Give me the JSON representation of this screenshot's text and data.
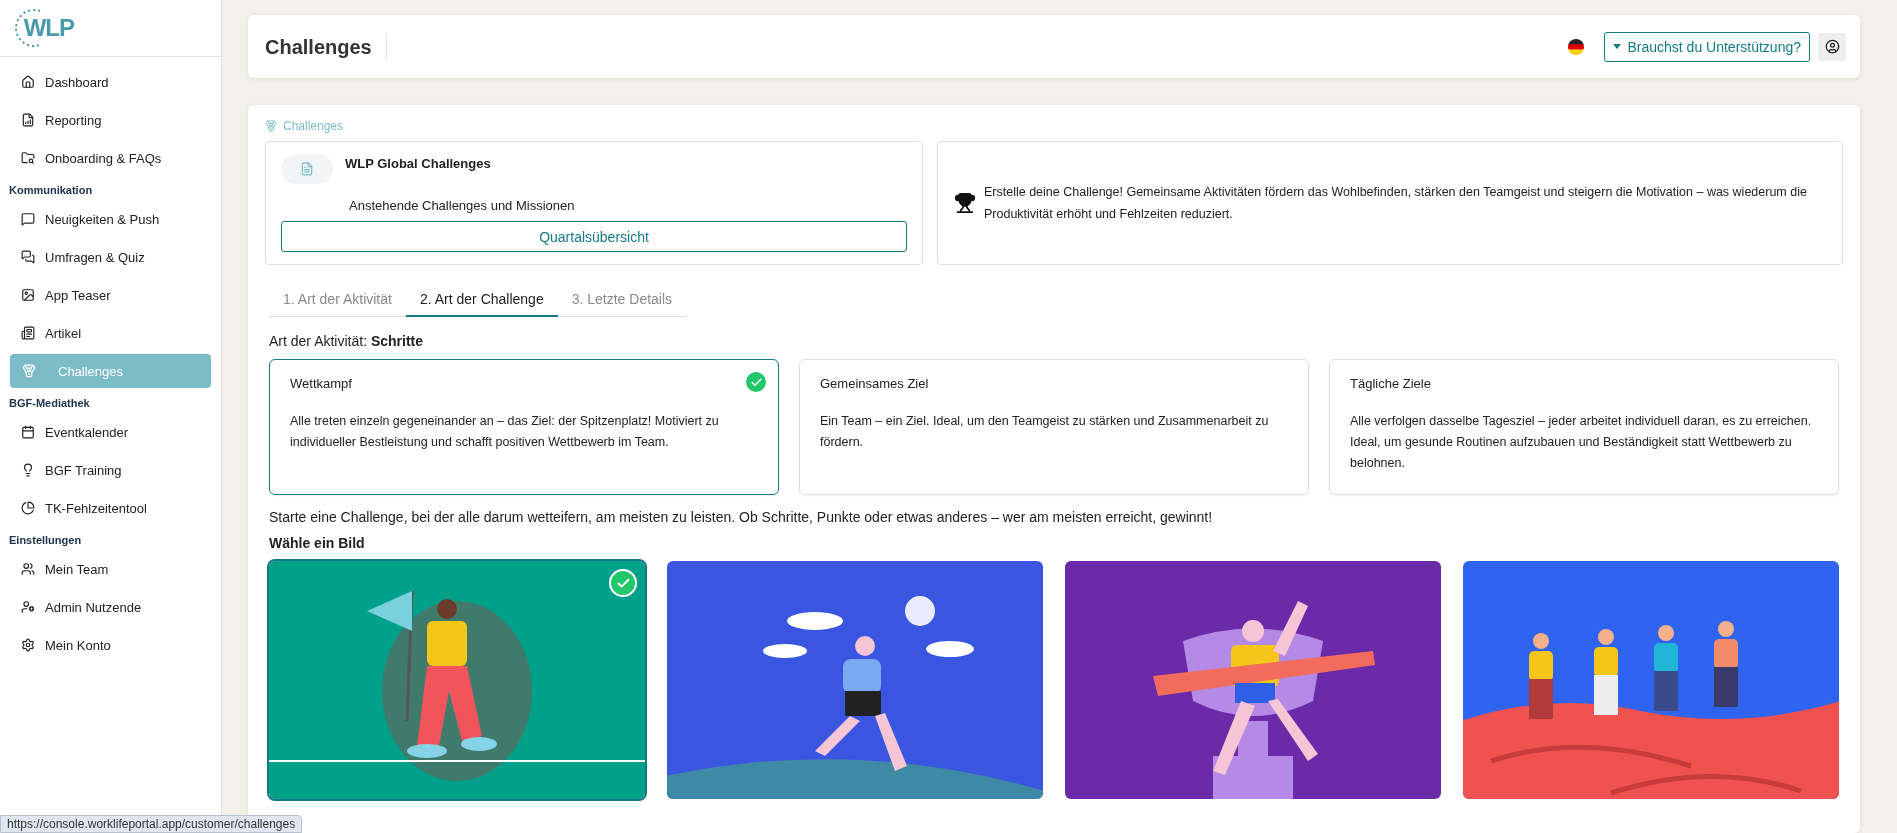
{
  "sidebar": {
    "logo": "WLP",
    "groups": [
      {
        "items": [
          {
            "label": "Dashboard",
            "selected": false
          },
          {
            "label": "Reporting",
            "selected": false
          },
          {
            "label": "Onboarding & FAQs",
            "selected": false
          }
        ]
      },
      {
        "heading": "Kommunikation",
        "items": [
          {
            "label": "Neuigkeiten & Push",
            "selected": false
          },
          {
            "label": "Umfragen & Quiz",
            "selected": false
          },
          {
            "label": "App Teaser",
            "selected": false
          },
          {
            "label": "Artikel",
            "selected": false
          },
          {
            "label": "Challenges",
            "selected": true
          }
        ]
      },
      {
        "heading": "BGF-Mediathek",
        "items": [
          {
            "label": "Eventkalender",
            "selected": false
          },
          {
            "label": "BGF Training",
            "selected": false
          },
          {
            "label": "TK-Fehlzeitentool",
            "selected": false
          }
        ]
      },
      {
        "heading": "Einstellungen",
        "items": [
          {
            "label": "Mein Team",
            "selected": false
          },
          {
            "label": "Admin Nutzende",
            "selected": false
          },
          {
            "label": "Mein Konto",
            "selected": false
          }
        ]
      }
    ]
  },
  "header": {
    "title": "Challenges",
    "help_button": "Brauchst du Unterstützung?"
  },
  "breadcrumb": "Challenges",
  "resource_card": {
    "title": "WLP Global Challenges",
    "subtitle": "Anstehende Challenges und Missionen",
    "button": "Quartalsübersicht"
  },
  "info_card": {
    "text": "Erstelle deine Challenge! Gemeinsame Aktivitäten fördern das Wohlbefinden, stärken den Teamgeist und steigern die Motivation – was wiederum die Produktivität erhöht und Fehlzeiten reduziert."
  },
  "tabs": [
    {
      "label": "1. Art der Aktivität",
      "selected": false
    },
    {
      "label": "2. Art der Challenge",
      "selected": true
    },
    {
      "label": "3. Letzte Details",
      "selected": false
    }
  ],
  "activity": "Art der Aktivität: **Schritte**",
  "challenge_types": [
    {
      "title": "Wettkampf",
      "description": "Alle treten einzeln gegeneinander an – das Ziel: der Spitzenplatz! Motiviert zu individueller Bestleistung und schafft positiven Wettbewerb im Team.",
      "selected": true
    },
    {
      "title": "Gemeinsames Ziel",
      "description": "Ein Team – ein Ziel. Ideal, um den Teamgeist zu stärken und Zusammenarbeit zu fördern.",
      "selected": false
    },
    {
      "title": "Tägliche Ziele",
      "description": "Alle verfolgen dasselbe Tagesziel – jeder arbeitet individuell daran, es zu erreichen. Ideal, um gesunde Routinen aufzubauen und Beständigkeit statt Wettbewerb zu belohnen.",
      "selected": false
    }
  ],
  "type_description": "Starte eine Challenge, bei der alle darum wetteifern, am meisten zu leisten. Ob Schritte, Punkte oder etwas anderes – wer am meisten erreicht, gewinnt!",
  "image_heading": "Wähle ein Bild",
  "images": [
    {
      "selected": true
    },
    {
      "selected": false
    },
    {
      "selected": false
    },
    {
      "selected": false
    }
  ],
  "status_url": "https://console.worklifeportal.app/customer/challenges"
}
